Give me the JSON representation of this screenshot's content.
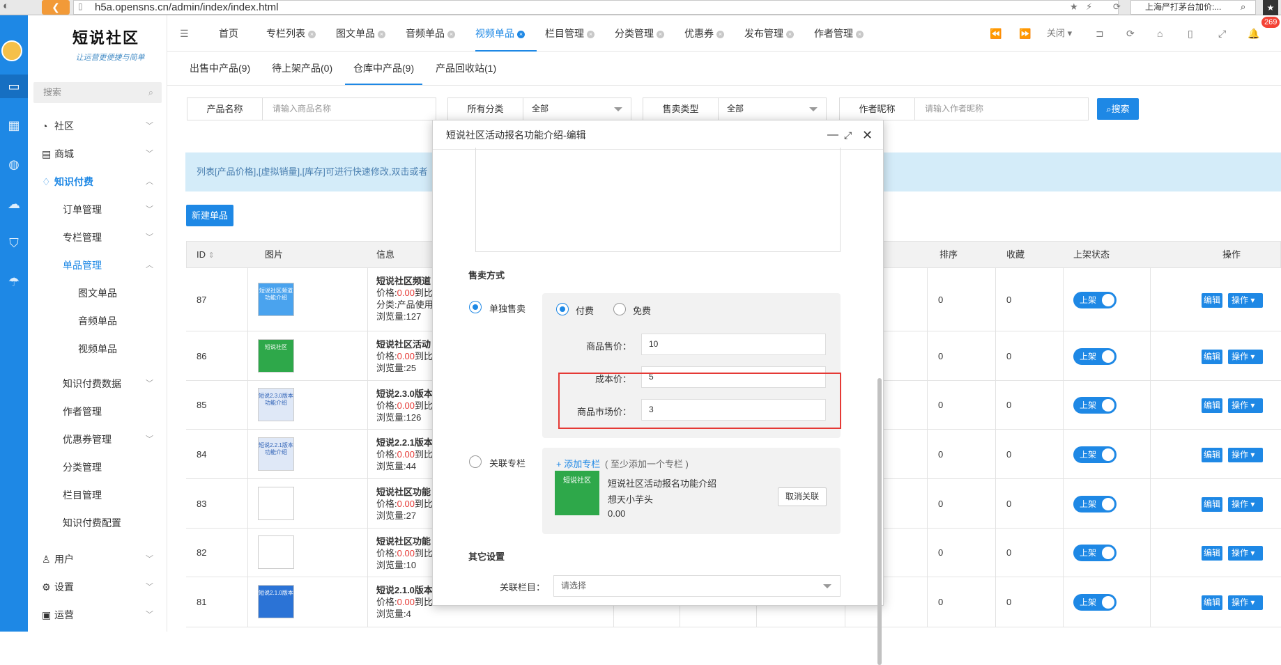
{
  "browser": {
    "url": "h5a.opensns.cn/admin/index/index.html",
    "search": "上海严打茅台加价:..."
  },
  "sidebar": {
    "logo": "短说社区",
    "slogan": "让运营更便捷与简单",
    "search_placeholder": "搜索",
    "items": [
      {
        "label": "社区"
      },
      {
        "label": "商城"
      },
      {
        "label": "知识付费"
      },
      {
        "label": "订单管理"
      },
      {
        "label": "专栏管理"
      },
      {
        "label": "单品管理"
      },
      {
        "label": "图文单品"
      },
      {
        "label": "音频单品"
      },
      {
        "label": "视频单品"
      },
      {
        "label": "知识付费数据"
      },
      {
        "label": "作者管理"
      },
      {
        "label": "优惠券管理"
      },
      {
        "label": "分类管理"
      },
      {
        "label": "栏目管理"
      },
      {
        "label": "知识付费配置"
      },
      {
        "label": "用户"
      },
      {
        "label": "设置"
      },
      {
        "label": "运营"
      }
    ]
  },
  "topnav": {
    "tabs": [
      "首页",
      "专栏列表",
      "图文单品",
      "音频单品",
      "视频单品",
      "栏目管理",
      "分类管理",
      "优惠券",
      "发布管理",
      "作者管理"
    ],
    "close_label": "关闭",
    "badge": "269"
  },
  "subtabs": [
    "出售中产品(9)",
    "待上架产品(0)",
    "仓库中产品(9)",
    "产品回收站(1)"
  ],
  "filters": {
    "name_label": "产品名称",
    "name_placeholder": "请输入商品名称",
    "cat_label": "所有分类",
    "cat_value": "全部",
    "type_label": "售卖类型",
    "type_value": "全部",
    "author_label": "作者昵称",
    "author_placeholder": "请输入作者昵称",
    "search_btn": "搜索"
  },
  "info_text": "列表[产品价格],[虚拟销量],[库存]可进行快速修改,双击或者",
  "new_btn": "新建单品",
  "table": {
    "headers": {
      "id": "ID",
      "img": "图片",
      "info": "信息",
      "sort": "排序",
      "fav": "收藏",
      "status": "上架状态",
      "ops": "操作"
    },
    "rows": [
      {
        "id": "87",
        "title": "短说社区频道",
        "price_prefix": "价格:",
        "price": "0.00",
        "price_suffix": "到比",
        "line3": "分类:产品使用",
        "views": "浏览量:127",
        "sort": "0",
        "fav": "0",
        "thumb": "短说社区频道功能介绍",
        "thumb_color": "#4aa3ee"
      },
      {
        "id": "86",
        "title": "短说社区活动",
        "price_prefix": "价格:",
        "price": "0.00",
        "price_suffix": "到比",
        "line3": "",
        "views": "浏览量:25",
        "sort": "0",
        "fav": "0",
        "thumb": "短说社区",
        "thumb_color": "#2ea84a"
      },
      {
        "id": "85",
        "title": "短说2.3.0版本",
        "price_prefix": "价格:",
        "price": "0.00",
        "price_suffix": "到比",
        "line3": "",
        "views": "浏览量:126",
        "sort": "0",
        "fav": "0",
        "thumb": "短说2.3.0版本功能介绍",
        "thumb_color": "#dfe8f7"
      },
      {
        "id": "84",
        "title": "短说2.2.1版本",
        "price_prefix": "价格:",
        "price": "0.00",
        "price_suffix": "到比",
        "line3": "",
        "views": "浏览量:44",
        "sort": "0",
        "fav": "0",
        "thumb": "短说2.2.1版本功能介绍",
        "thumb_color": "#dfe8f7"
      },
      {
        "id": "83",
        "title": "短说社区功能",
        "price_prefix": "价格:",
        "price": "0.00",
        "price_suffix": "到比",
        "line3": "",
        "views": "浏览量:27",
        "sort": "0",
        "fav": "0",
        "thumb": "",
        "thumb_color": "#ffffff"
      },
      {
        "id": "82",
        "title": "短说社区功能",
        "price_prefix": "价格:",
        "price": "0.00",
        "price_suffix": "到比",
        "line3": "",
        "views": "浏览量:10",
        "sort": "0",
        "fav": "0",
        "thumb": "",
        "thumb_color": "#ffffff"
      },
      {
        "id": "81",
        "title": "短说2.1.0版本",
        "price_prefix": "价格:",
        "price": "0.00",
        "price_suffix": "到比",
        "line3": "",
        "views": "浏览量:4",
        "sort": "0",
        "fav": "0",
        "thumb": "短说2.1.0版本",
        "thumb_color": "#2b73d6"
      }
    ],
    "status_label": "上架",
    "edit_label": "编辑",
    "ops_label": "操作"
  },
  "modal": {
    "title": "短说社区活动报名功能介绍-编辑",
    "sale_section": "售卖方式",
    "single_sale": "单独售卖",
    "paid": "付费",
    "free": "免费",
    "price_label": "商品售价：",
    "price_value": "10",
    "cost_label": "成本价：",
    "cost_value": "5",
    "market_label": "商品市场价：",
    "market_value": "3",
    "column_sale": "关联专栏",
    "add_column": "+ 添加专栏",
    "add_hint": "( 至少添加一个专栏 )",
    "linked_title": "短说社区活动报名功能介绍",
    "linked_author": "想天小芋头",
    "linked_price": "0.00",
    "linked_thumb": "短说社区",
    "cancel_link": "取消关联",
    "other_section": "其它设置",
    "column_label": "关联栏目：",
    "column_placeholder": "请选择"
  },
  "colors": {
    "accent": "#1e88e5",
    "red": "#e53935",
    "price_red": "#e53935"
  }
}
